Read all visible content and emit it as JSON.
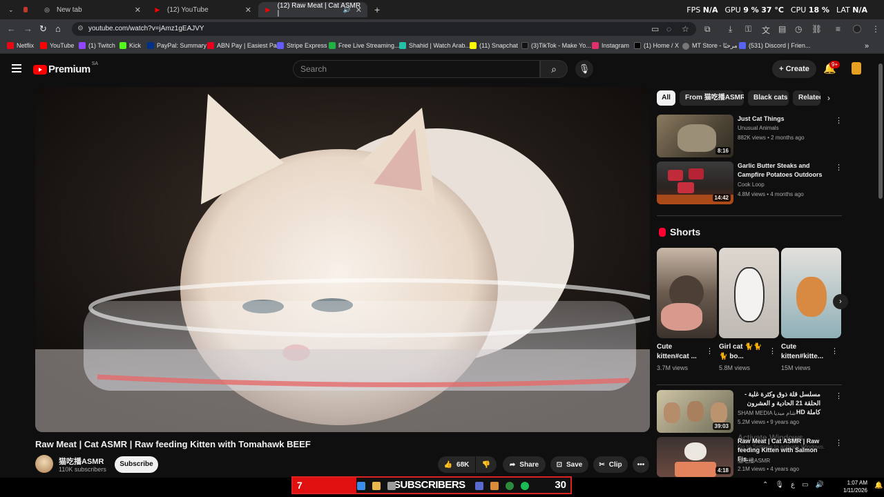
{
  "browser": {
    "tabs": [
      {
        "title": "",
        "favicon": "app-icon"
      },
      {
        "title": "New tab",
        "favicon": "chrome-icon"
      },
      {
        "title": "(12) YouTube",
        "favicon": "youtube-icon"
      },
      {
        "title": "(12) Raw Meat | Cat ASMR |",
        "favicon": "youtube-icon",
        "audio": true
      }
    ],
    "perf": {
      "fps_label": "FPS",
      "fps": "N/A",
      "gpu_label": "GPU",
      "gpu": "9 %",
      "gpu_temp": "37 °C",
      "cpu_label": "CPU",
      "cpu": "18 %",
      "lat_label": "LAT",
      "lat": "N/A"
    },
    "url": "youtube.com/watch?v=jAmz1gEAJVY",
    "bookmarks": [
      {
        "label": "Netflix",
        "color": "#e50914"
      },
      {
        "label": "YouTube",
        "color": "#ff0000"
      },
      {
        "label": "(1) Twitch",
        "color": "#9146ff"
      },
      {
        "label": "Kick",
        "color": "#53fc18"
      },
      {
        "label": "PayPal: Summary",
        "color": "#003087"
      },
      {
        "label": "ABN Pay | Easiest Pa...",
        "color": "#e8001c"
      },
      {
        "label": "Stripe Express",
        "color": "#635bff"
      },
      {
        "label": "Free Live Streaming...",
        "color": "#1fb141"
      },
      {
        "label": "Shahid | Watch Arab...",
        "color": "#22c1a8"
      },
      {
        "label": "(11) Snapchat",
        "color": "#fffc00"
      },
      {
        "label": "(3)TikTok - Make Yo...",
        "color": "#111111"
      },
      {
        "label": "Instagram",
        "color": "#e1306c"
      },
      {
        "label": "(1) Home / X",
        "color": "#000000"
      },
      {
        "label": "MT Store - مرحبًا",
        "color": "#777777"
      },
      {
        "label": "(531) Discord | Frien...",
        "color": "#5865f2"
      }
    ]
  },
  "yt": {
    "logo_text": "Premium",
    "logo_region": "SA",
    "search_placeholder": "Search",
    "create_label": "Create",
    "notif_count": "9+",
    "video": {
      "title": "Raw Meat | Cat ASMR | Raw feeding Kitten with Tomahawk BEEF",
      "channel": "猫吃播ASMR",
      "subscribers": "110K subscribers",
      "subscribe_label": "Subscribe",
      "likes": "68K",
      "share_label": "Share",
      "save_label": "Save",
      "clip_label": "Clip"
    },
    "chips": [
      "All",
      "From 猫吃播ASMR",
      "Black cats",
      "Related"
    ],
    "recommendations": [
      {
        "title": "Just Cat Things",
        "channel": "Unusual Animals",
        "meta": "882K views • 2 months ago",
        "duration": "8:16"
      },
      {
        "title": "Garlic Butter Steaks and Campfire Potatoes Outdoors",
        "channel": "Cook Loop",
        "meta": "4.8M views • 4 months ago",
        "duration": "14:42"
      }
    ],
    "shorts_heading": "Shorts",
    "shorts": [
      {
        "title": "Cute kitten#cat ...",
        "views": "3.7M views"
      },
      {
        "title": "Girl cat 🐈🐈🐈 bo...",
        "views": "5.8M views"
      },
      {
        "title": "Cute kitten#kitte...",
        "views": "15M views"
      }
    ],
    "more_recommendations": [
      {
        "title": "مسلسل قلة ذوق وكثرة غلبة - الحلقة 21 الحادية و العشرون كاملة HD",
        "channel": "SHAM MEDIA شام ميديا",
        "meta": "5.2M views • 9 years ago",
        "duration": "39:03"
      },
      {
        "title": "Raw Meat | Cat ASMR | Raw feeding Kitten with Salmon Fis...",
        "channel": "猫吃播ASMR",
        "meta": "2.1M views • 4 years ago",
        "duration": "4:18"
      }
    ],
    "watermark": "Activate Windows",
    "watermark_sub": "Go to Settings to activate Windows."
  },
  "taskbar": {
    "counter_value": "7",
    "counter_label": "SUBSCRIBERS",
    "counter_num": "30",
    "time": "1:07 AM",
    "date": "1/11/2026",
    "lang": "ع"
  }
}
